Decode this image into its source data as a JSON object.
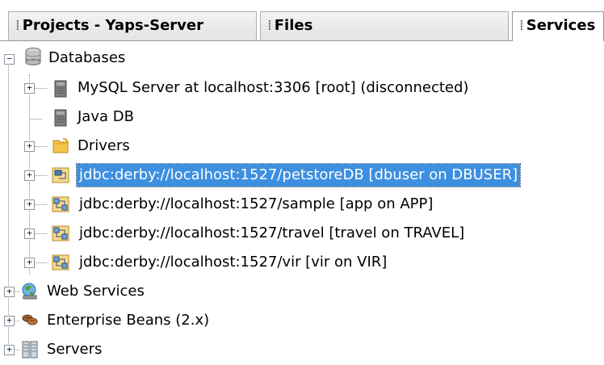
{
  "tabs": [
    {
      "label": "Projects - Yaps-Server",
      "active": false
    },
    {
      "label": "Files",
      "active": false
    },
    {
      "label": "Services",
      "active": true
    }
  ],
  "tree": {
    "databases": {
      "label": "Databases",
      "children": [
        {
          "label": "MySQL Server at localhost:3306 [root] (disconnected)",
          "icon": "database-server-icon"
        },
        {
          "label": "Java DB",
          "icon": "database-server-icon"
        },
        {
          "label": "Drivers",
          "icon": "folder-icon"
        },
        {
          "label": "jdbc:derby://localhost:1527/petstoreDB [dbuser on DBUSER]",
          "icon": "connection-icon",
          "selected": true
        },
        {
          "label": "jdbc:derby://localhost:1527/sample [app on APP]",
          "icon": "connection-icon"
        },
        {
          "label": "jdbc:derby://localhost:1527/travel [travel on TRAVEL]",
          "icon": "connection-icon"
        },
        {
          "label": "jdbc:derby://localhost:1527/vir [vir on VIR]",
          "icon": "connection-icon"
        }
      ]
    },
    "web_services": {
      "label": "Web Services",
      "icon": "web-services-icon"
    },
    "enterprise_beans": {
      "label": "Enterprise Beans (2.x)",
      "icon": "beans-icon"
    },
    "servers": {
      "label": "Servers",
      "icon": "servers-icon"
    }
  },
  "colors": {
    "selection": "#3d8fe0",
    "guides": "#8a8a8a"
  }
}
